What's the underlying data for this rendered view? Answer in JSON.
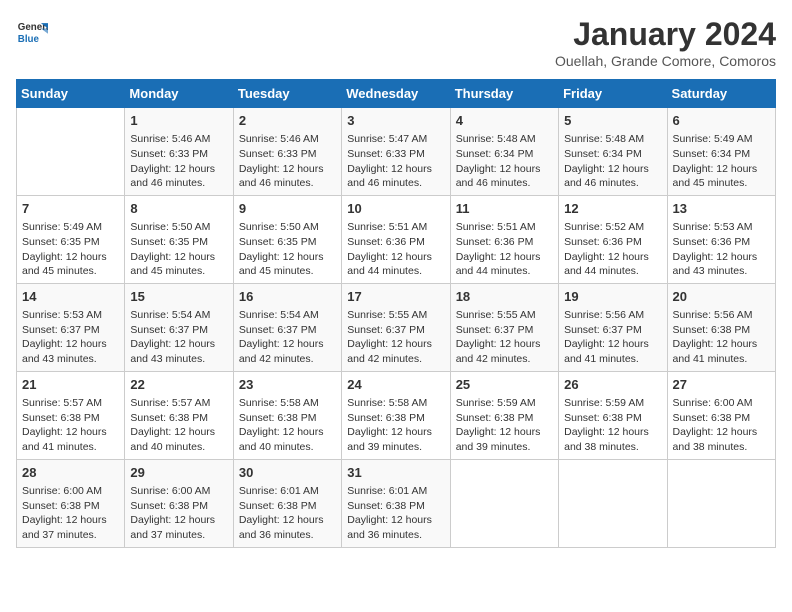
{
  "header": {
    "logo_line1": "General",
    "logo_line2": "Blue",
    "month": "January 2024",
    "location": "Ouellah, Grande Comore, Comoros"
  },
  "days_of_week": [
    "Sunday",
    "Monday",
    "Tuesday",
    "Wednesday",
    "Thursday",
    "Friday",
    "Saturday"
  ],
  "weeks": [
    [
      {
        "day": "",
        "content": ""
      },
      {
        "day": "1",
        "content": "Sunrise: 5:46 AM\nSunset: 6:33 PM\nDaylight: 12 hours and 46 minutes."
      },
      {
        "day": "2",
        "content": "Sunrise: 5:46 AM\nSunset: 6:33 PM\nDaylight: 12 hours and 46 minutes."
      },
      {
        "day": "3",
        "content": "Sunrise: 5:47 AM\nSunset: 6:33 PM\nDaylight: 12 hours and 46 minutes."
      },
      {
        "day": "4",
        "content": "Sunrise: 5:48 AM\nSunset: 6:34 PM\nDaylight: 12 hours and 46 minutes."
      },
      {
        "day": "5",
        "content": "Sunrise: 5:48 AM\nSunset: 6:34 PM\nDaylight: 12 hours and 46 minutes."
      },
      {
        "day": "6",
        "content": "Sunrise: 5:49 AM\nSunset: 6:34 PM\nDaylight: 12 hours and 45 minutes."
      }
    ],
    [
      {
        "day": "7",
        "content": "Sunrise: 5:49 AM\nSunset: 6:35 PM\nDaylight: 12 hours and 45 minutes."
      },
      {
        "day": "8",
        "content": "Sunrise: 5:50 AM\nSunset: 6:35 PM\nDaylight: 12 hours and 45 minutes."
      },
      {
        "day": "9",
        "content": "Sunrise: 5:50 AM\nSunset: 6:35 PM\nDaylight: 12 hours and 45 minutes."
      },
      {
        "day": "10",
        "content": "Sunrise: 5:51 AM\nSunset: 6:36 PM\nDaylight: 12 hours and 44 minutes."
      },
      {
        "day": "11",
        "content": "Sunrise: 5:51 AM\nSunset: 6:36 PM\nDaylight: 12 hours and 44 minutes."
      },
      {
        "day": "12",
        "content": "Sunrise: 5:52 AM\nSunset: 6:36 PM\nDaylight: 12 hours and 44 minutes."
      },
      {
        "day": "13",
        "content": "Sunrise: 5:53 AM\nSunset: 6:36 PM\nDaylight: 12 hours and 43 minutes."
      }
    ],
    [
      {
        "day": "14",
        "content": "Sunrise: 5:53 AM\nSunset: 6:37 PM\nDaylight: 12 hours and 43 minutes."
      },
      {
        "day": "15",
        "content": "Sunrise: 5:54 AM\nSunset: 6:37 PM\nDaylight: 12 hours and 43 minutes."
      },
      {
        "day": "16",
        "content": "Sunrise: 5:54 AM\nSunset: 6:37 PM\nDaylight: 12 hours and 42 minutes."
      },
      {
        "day": "17",
        "content": "Sunrise: 5:55 AM\nSunset: 6:37 PM\nDaylight: 12 hours and 42 minutes."
      },
      {
        "day": "18",
        "content": "Sunrise: 5:55 AM\nSunset: 6:37 PM\nDaylight: 12 hours and 42 minutes."
      },
      {
        "day": "19",
        "content": "Sunrise: 5:56 AM\nSunset: 6:37 PM\nDaylight: 12 hours and 41 minutes."
      },
      {
        "day": "20",
        "content": "Sunrise: 5:56 AM\nSunset: 6:38 PM\nDaylight: 12 hours and 41 minutes."
      }
    ],
    [
      {
        "day": "21",
        "content": "Sunrise: 5:57 AM\nSunset: 6:38 PM\nDaylight: 12 hours and 41 minutes."
      },
      {
        "day": "22",
        "content": "Sunrise: 5:57 AM\nSunset: 6:38 PM\nDaylight: 12 hours and 40 minutes."
      },
      {
        "day": "23",
        "content": "Sunrise: 5:58 AM\nSunset: 6:38 PM\nDaylight: 12 hours and 40 minutes."
      },
      {
        "day": "24",
        "content": "Sunrise: 5:58 AM\nSunset: 6:38 PM\nDaylight: 12 hours and 39 minutes."
      },
      {
        "day": "25",
        "content": "Sunrise: 5:59 AM\nSunset: 6:38 PM\nDaylight: 12 hours and 39 minutes."
      },
      {
        "day": "26",
        "content": "Sunrise: 5:59 AM\nSunset: 6:38 PM\nDaylight: 12 hours and 38 minutes."
      },
      {
        "day": "27",
        "content": "Sunrise: 6:00 AM\nSunset: 6:38 PM\nDaylight: 12 hours and 38 minutes."
      }
    ],
    [
      {
        "day": "28",
        "content": "Sunrise: 6:00 AM\nSunset: 6:38 PM\nDaylight: 12 hours and 37 minutes."
      },
      {
        "day": "29",
        "content": "Sunrise: 6:00 AM\nSunset: 6:38 PM\nDaylight: 12 hours and 37 minutes."
      },
      {
        "day": "30",
        "content": "Sunrise: 6:01 AM\nSunset: 6:38 PM\nDaylight: 12 hours and 36 minutes."
      },
      {
        "day": "31",
        "content": "Sunrise: 6:01 AM\nSunset: 6:38 PM\nDaylight: 12 hours and 36 minutes."
      },
      {
        "day": "",
        "content": ""
      },
      {
        "day": "",
        "content": ""
      },
      {
        "day": "",
        "content": ""
      }
    ]
  ],
  "colors": {
    "header_bg": "#1a6eb5",
    "header_text": "#ffffff",
    "accent_blue": "#1a6eb5"
  }
}
